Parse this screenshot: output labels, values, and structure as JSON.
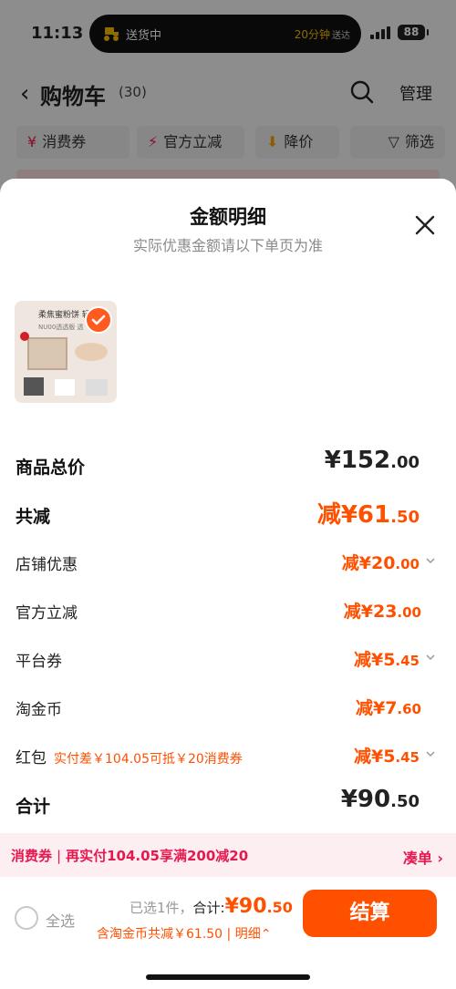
{
  "status_bar": {
    "time": "11:13",
    "battery": "88"
  },
  "live_activity": {
    "left_label": "送货中",
    "eta": "20分钟",
    "eta_suffix": "送达"
  },
  "header": {
    "title": "购物车",
    "count": "(30)",
    "manage_label": "管理"
  },
  "filters": [
    {
      "label": "消费券",
      "icon": "coupon-icon"
    },
    {
      "label": "官方立减",
      "icon": "lightning-icon"
    },
    {
      "label": "降价",
      "icon": "down-arrow-icon"
    },
    {
      "label": "筛选",
      "icon": "filter-icon"
    }
  ],
  "sheet": {
    "title": "金额明细",
    "subtitle": "实际优惠金额请以下单页为准",
    "product": {
      "line1": "柔焦蜜粉饼 轻透",
      "line2": "NU00透透版 透"
    },
    "rows": [
      {
        "label": "商品总价",
        "value": "¥152",
        "decimals": ".00",
        "style": "total"
      },
      {
        "label": "共减",
        "value": "减¥61",
        "decimals": ".50",
        "style": "big"
      },
      {
        "label": "店铺优惠",
        "value": "减¥20",
        "decimals": ".00",
        "chevron": true
      },
      {
        "label": "官方立减",
        "value": "减¥23",
        "decimals": ".00"
      },
      {
        "label": "平台券",
        "value": "减¥5",
        "decimals": ".45",
        "chevron": true
      },
      {
        "label": "淘金币",
        "value": "减¥7",
        "decimals": ".60"
      },
      {
        "label": "红包",
        "note": "实付差￥104.05可抵￥20消费券",
        "value": "减¥5",
        "decimals": ".45",
        "chevron": true
      },
      {
        "label": "合计",
        "value": "¥90",
        "decimals": ".50",
        "style": "total"
      }
    ]
  },
  "promo": {
    "tag": "消费券",
    "text": "再实付104.05享满200减20",
    "action": "凑单"
  },
  "footer": {
    "select_all": "全选",
    "selected": "已选1件，",
    "total_label": "合计:",
    "total": "¥90",
    "total_decimals": ".50",
    "discount_line": "含淘金币共减￥61.50",
    "detail_label": "明细",
    "pay_label": "结算"
  },
  "colors": {
    "accent": "#ff5000",
    "promo": "#e5194f"
  }
}
